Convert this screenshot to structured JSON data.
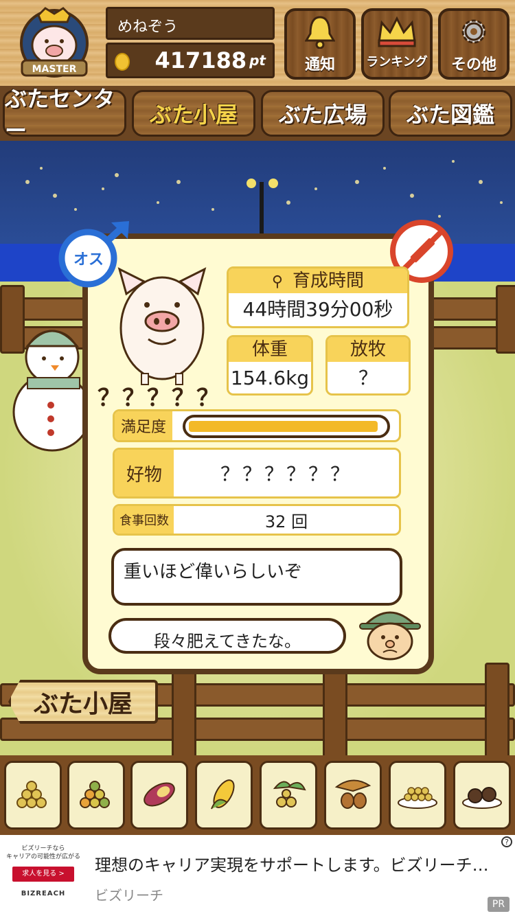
{
  "header": {
    "badge_label": "MASTER",
    "user_name": "めねぞう",
    "points_value": "417188",
    "points_unit": "pt",
    "buttons": [
      {
        "label": "通知",
        "icon": "bell-icon"
      },
      {
        "label": "ランキング",
        "icon": "crown-icon"
      },
      {
        "label": "その他",
        "icon": "gear-icon"
      }
    ]
  },
  "nav": {
    "tabs": [
      {
        "label": "ぶたセンター",
        "active": false
      },
      {
        "label": "ぶた小屋",
        "active": true
      },
      {
        "label": "ぶた広場",
        "active": false
      },
      {
        "label": "ぶた図鑑",
        "active": false
      }
    ]
  },
  "pig": {
    "gender": "オス",
    "name": "？？？？？",
    "growth_label": "育成時間",
    "growth_value": "44時間39分00秒",
    "weight_label": "体重",
    "weight_value": "154.6kg",
    "grazing_label": "放牧",
    "grazing_value": "？",
    "satisfaction_label": "満足度",
    "satisfaction_level": 0.97,
    "favorite_label": "好物",
    "favorite_value": "？？？？？？",
    "meals_label": "食事回数",
    "meals_value": "32 回"
  },
  "dialog": {
    "hint": "重いほど偉いらしいぞ",
    "farmer_says": "段々肥えてきたな。"
  },
  "sign": {
    "label": "ぶた小屋"
  },
  "food_items": [
    {
      "icon": "soybeans-icon"
    },
    {
      "icon": "mixed-beans-icon"
    },
    {
      "icon": "sweet-potato-icon"
    },
    {
      "icon": "corn-icon"
    },
    {
      "icon": "nuts-icon"
    },
    {
      "icon": "acorn-icon"
    },
    {
      "icon": "grain-plate-icon"
    },
    {
      "icon": "meatball-plate-icon"
    }
  ],
  "ad": {
    "logo_line1": "ビズリーチなら",
    "logo_line2": "キャリアの可能性が広がる",
    "cta": "求人を見る >",
    "brand": "BIZREACH",
    "title": "理想のキャリア実現をサポートします。ビズリーチ…",
    "advertiser": "ビズリーチ",
    "pr": "PR",
    "info": "?"
  },
  "colors": {
    "wood_dark": "#5a3a1c",
    "accent_yellow": "#f8d35a",
    "male_blue": "#2a6fd6",
    "no_shot_red": "#d9452b"
  }
}
